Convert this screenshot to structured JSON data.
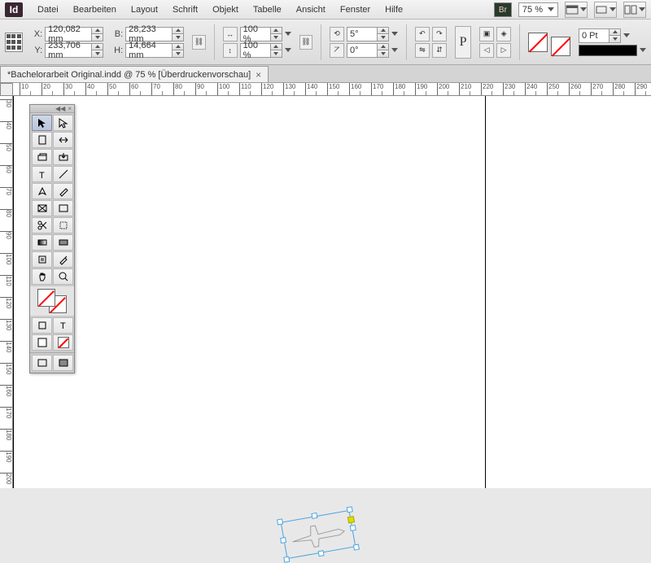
{
  "app": {
    "logo": "Id",
    "bridge": "Br"
  },
  "menu": [
    "Datei",
    "Bearbeiten",
    "Layout",
    "Schrift",
    "Objekt",
    "Tabelle",
    "Ansicht",
    "Fenster",
    "Hilfe"
  ],
  "zoom": "75 %",
  "coords": {
    "x_label": "X:",
    "x": "120,082 mm",
    "y_label": "Y:",
    "y": "233,706 mm",
    "w_label": "B:",
    "w": "28,233 mm",
    "h_label": "H:",
    "h": "14,664 mm"
  },
  "scale": {
    "x": "100 %",
    "y": "100 %"
  },
  "rotate": "5°",
  "shear": "0°",
  "stroke_weight": "0 Pt",
  "doc_tab": "*Bachelorarbeit Original.indd @ 75 % [Überdruckenvorschau]",
  "ruler_h": [
    10,
    20,
    30,
    40,
    50,
    60,
    70,
    80,
    90,
    100,
    110,
    120,
    130,
    140,
    150,
    160,
    170,
    180,
    190,
    200,
    210,
    220,
    230,
    240,
    250,
    260,
    270,
    280,
    290
  ],
  "ruler_v": [
    30,
    40,
    50,
    60,
    70,
    80,
    90,
    100,
    110,
    120,
    130,
    140,
    150,
    160,
    170,
    180,
    190,
    200
  ]
}
